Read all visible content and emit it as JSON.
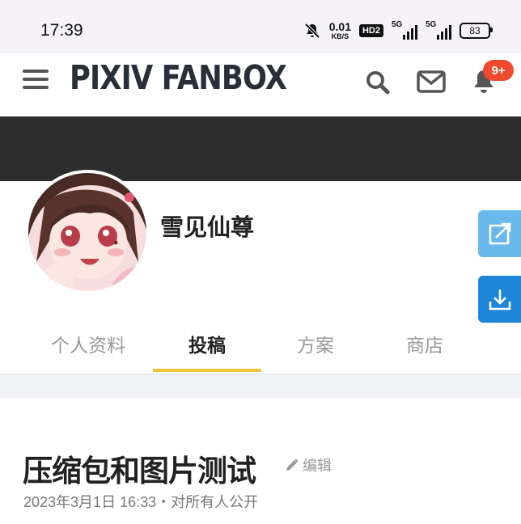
{
  "status_bar": {
    "time": "17:39",
    "net_speed_value": "0.01",
    "net_speed_unit": "KB/S",
    "hd_label": "HD2",
    "sim1_label": "5G",
    "sim2_label": "5G",
    "battery": "83",
    "icons": [
      "mute-bell-icon",
      "signal-icon",
      "battery-icon"
    ]
  },
  "header": {
    "logo": "PIXIV FANBOX",
    "notification_badge": "9+",
    "icons": [
      "menu-icon",
      "search-icon",
      "mail-icon",
      "bell-icon"
    ]
  },
  "creator": {
    "name": "雪见仙尊"
  },
  "tabs": [
    {
      "label": "个人资料",
      "active": false
    },
    {
      "label": "投稿",
      "active": true
    },
    {
      "label": "方案",
      "active": false
    },
    {
      "label": "商店",
      "active": false
    }
  ],
  "side_actions": [
    "external-link-icon",
    "download-icon"
  ],
  "post": {
    "title": "压缩包和图片测试",
    "edit_label": "编辑",
    "meta": "2023年3月1日 16:33・对所有人公开"
  },
  "colors": {
    "accent_tab": "#f2c33c",
    "badge": "#f04a2e",
    "cover": "#2d2d2d",
    "side_share": "#6bb8ec",
    "side_download": "#1e86d8"
  }
}
